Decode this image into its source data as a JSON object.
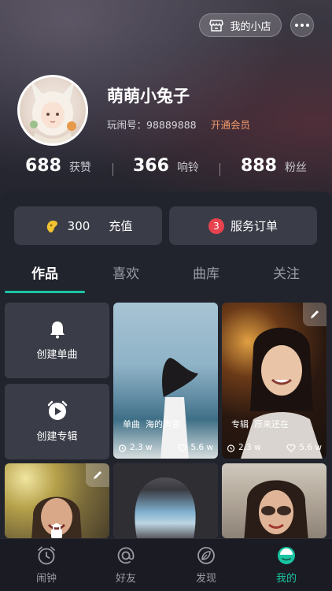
{
  "header": {
    "shop_label": "我的小店",
    "nickname": "萌萌小兔子",
    "uid_text": "玩闹号：98889888",
    "vip_label": "开通会员"
  },
  "stats": [
    {
      "value": "688",
      "label": "获赞"
    },
    {
      "value": "366",
      "label": "响铃"
    },
    {
      "value": "888",
      "label": "粉丝"
    }
  ],
  "actions": {
    "coins": "300",
    "recharge_label": "充值",
    "order_badge": "3",
    "order_label": "服务订单"
  },
  "tabs": [
    "作品",
    "喜欢",
    "曲库",
    "关注"
  ],
  "create": {
    "single_label": "创建单曲",
    "album_label": "创建专辑"
  },
  "works": [
    {
      "type": "单曲",
      "title": "海的声音",
      "plays": "2.3 w",
      "likes": "5.6 w"
    },
    {
      "type": "专辑",
      "title": "原来还在",
      "plays": "2.3 w",
      "likes": "5.6 w"
    }
  ],
  "nav": [
    "闹钟",
    "好友",
    "发现",
    "我的"
  ],
  "colors": {
    "accent": "#19c5a2",
    "vip": "#f29a6b",
    "badge": "#e8424f"
  }
}
